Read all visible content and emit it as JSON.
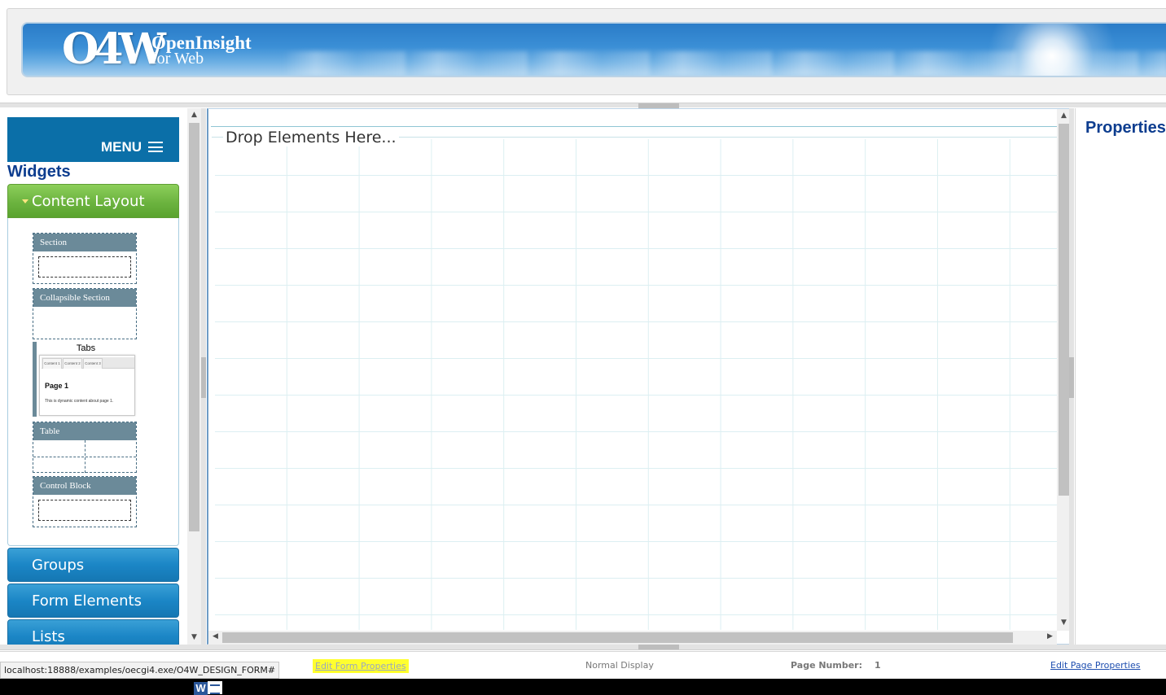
{
  "header": {
    "logo_mark": "O4W",
    "logo_line1": "OpenInsight",
    "logo_line2": "for Web"
  },
  "left_panel": {
    "menu_label": "MENU",
    "menu_icon": "hamburger-icon",
    "widgets_title": "Widgets",
    "accordion": [
      {
        "label": "Content Layout",
        "expanded": true
      },
      {
        "label": "Groups",
        "expanded": false
      },
      {
        "label": "Form Elements",
        "expanded": false
      },
      {
        "label": "Lists",
        "expanded": false
      }
    ],
    "widgets": {
      "section": "Section",
      "collapsible_section": "Collapsible Section",
      "tabs": {
        "label": "Tabs",
        "tab_names": [
          "Content 1",
          "Content 2",
          "Content 3"
        ],
        "page_title": "Page 1",
        "page_text": "This is dynamic content about page 1."
      },
      "table": "Table",
      "control_block": "Control Block"
    }
  },
  "canvas": {
    "drop_hint": "Drop Elements Here..."
  },
  "right_panel": {
    "title": "Properties"
  },
  "footer": {
    "status_url": "localhost:18888/examples/oecgi4.exe/O4W_DESIGN_FORM#",
    "edit_form_properties": "Edit Form Properties",
    "display_mode": "Normal Display",
    "page_number_label": "Page Number:",
    "page_number_value": "1",
    "edit_page_properties": "Edit Page Properties"
  },
  "taskbar": {
    "app_icon": "word-icon",
    "app_letter": "W"
  },
  "colors": {
    "menu_bar": "#0b6fa8",
    "title_blue": "#0d3d8f",
    "content_layout_green": "#6cb33f",
    "accordion_blue": "#1b86c6",
    "highlight_yellow": "#ffff2e"
  }
}
